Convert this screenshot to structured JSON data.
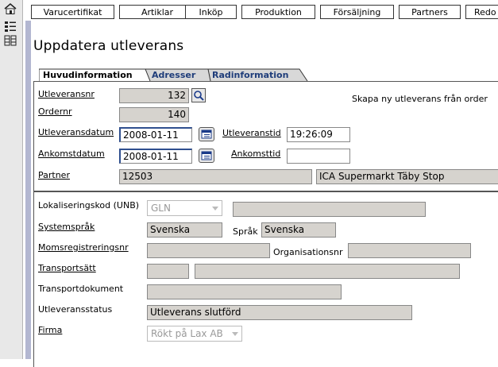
{
  "nav_tabs": [
    "Varucertifikat",
    "Artiklar",
    "Inköp",
    "Produktion",
    "Försäljning",
    "Partners",
    "Redo"
  ],
  "page_title": "Uppdatera utleverans",
  "form_tabs": [
    "Huvudinformation",
    "Adresser",
    "Radinformation"
  ],
  "create_link": "Skapa ny utleverans från order",
  "fields": {
    "utleveransnr": {
      "label": "Utleveransnr",
      "value": "132"
    },
    "ordernr": {
      "label": "Ordernr",
      "value": "140"
    },
    "utleveransdatum": {
      "label": "Utleveransdatum",
      "value": "2008-01-11"
    },
    "utleveranstid": {
      "label": "Utleveranstid",
      "value": "19:26:09"
    },
    "ankomstdatum": {
      "label": "Ankomstdatum",
      "value": "2008-01-11"
    },
    "ankomsttid": {
      "label": "Ankomsttid",
      "value": ""
    },
    "partner": {
      "label": "Partner",
      "value": "12503",
      "name": "ICA Supermarkt Täby Stop"
    },
    "lokaliseringskod": {
      "label": "Lokaliseringskod (UNB)",
      "value": "GLN",
      "extra": ""
    },
    "systemsprak": {
      "label": "Systemspråk",
      "value": "Svenska"
    },
    "sprak": {
      "label": "Språk",
      "value": "Svenska"
    },
    "momsregistreringsnr": {
      "label": "Momsregistreringsnr",
      "value": ""
    },
    "organisationsnr": {
      "label": "Organisationsnr",
      "value": ""
    },
    "transportsatt": {
      "label": "Transportsätt",
      "value": "",
      "description": ""
    },
    "transportdokument": {
      "label": "Transportdokument",
      "value": ""
    },
    "utleveransstatus": {
      "label": "Utleveransstatus",
      "value": "Utleverans slutförd"
    },
    "firma": {
      "label": "Firma",
      "value": "Rökt på Lax AB"
    }
  }
}
